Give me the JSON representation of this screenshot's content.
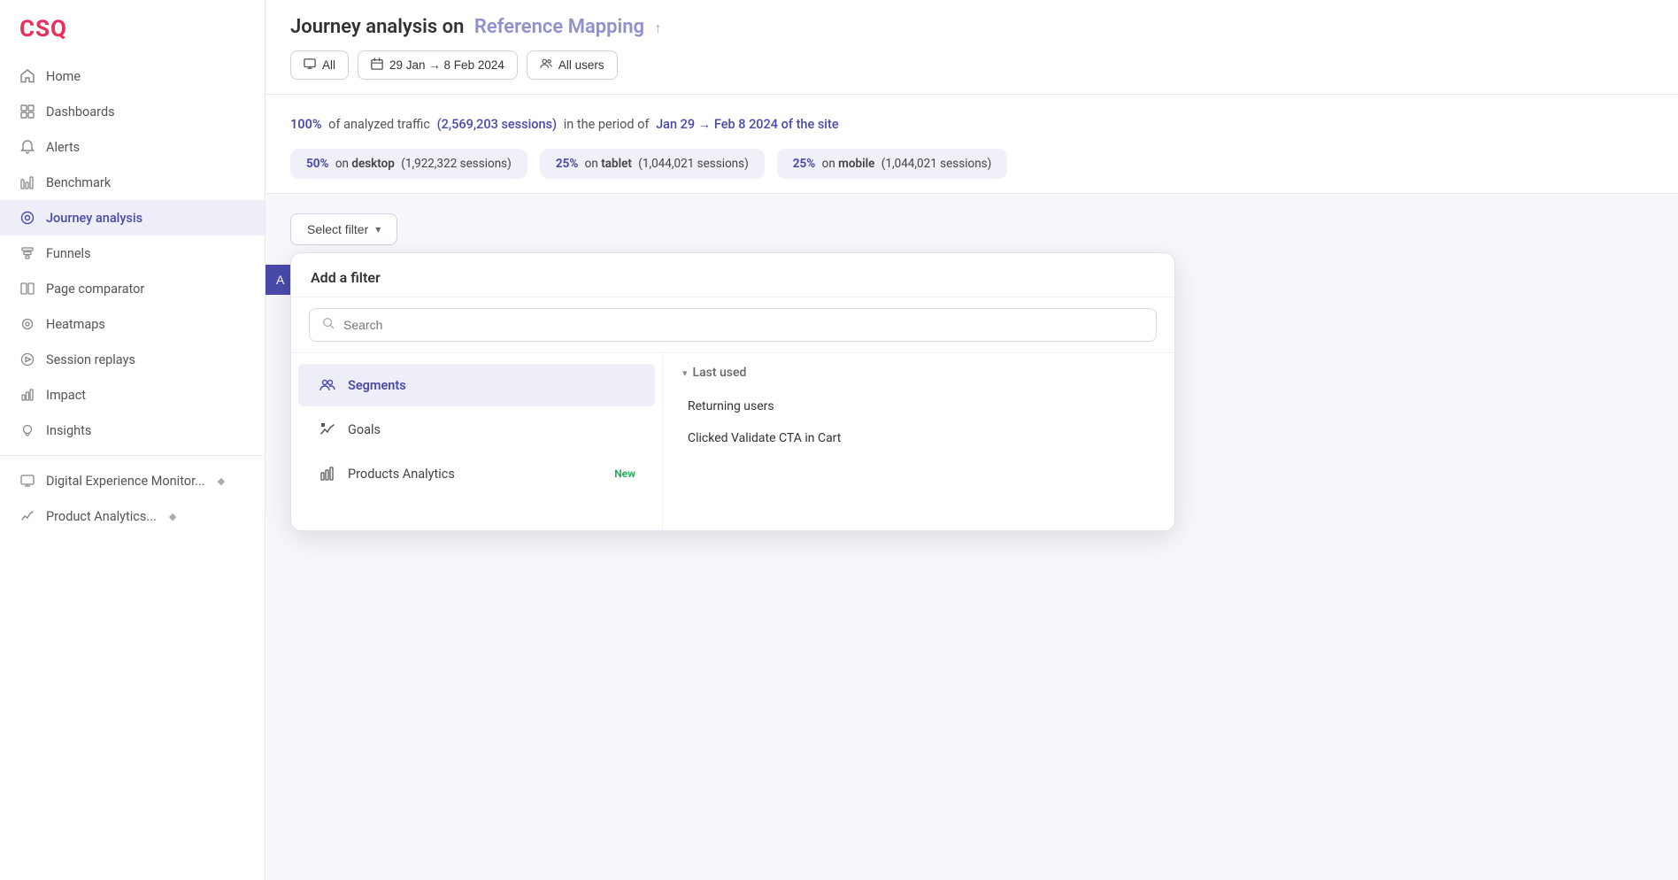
{
  "brand": {
    "logo": "CSQ",
    "logo_color": "#e8305a"
  },
  "sidebar": {
    "items": [
      {
        "id": "home",
        "label": "Home",
        "icon": "home"
      },
      {
        "id": "dashboards",
        "label": "Dashboards",
        "icon": "dashboards"
      },
      {
        "id": "alerts",
        "label": "Alerts",
        "icon": "alerts"
      },
      {
        "id": "benchmark",
        "label": "Benchmark",
        "icon": "benchmark"
      },
      {
        "id": "journey-analysis",
        "label": "Journey analysis",
        "icon": "journey",
        "active": true
      },
      {
        "id": "funnels",
        "label": "Funnels",
        "icon": "funnels"
      },
      {
        "id": "page-comparator",
        "label": "Page comparator",
        "icon": "page-comparator"
      },
      {
        "id": "heatmaps",
        "label": "Heatmaps",
        "icon": "heatmaps"
      },
      {
        "id": "session-replays",
        "label": "Session replays",
        "icon": "session-replays"
      },
      {
        "id": "impact",
        "label": "Impact",
        "icon": "impact"
      },
      {
        "id": "insights",
        "label": "Insights",
        "icon": "insights"
      }
    ],
    "bottom_items": [
      {
        "id": "digital-experience",
        "label": "Digital Experience Monitor...",
        "badge": "◆"
      },
      {
        "id": "product-analytics",
        "label": "Product Analytics...",
        "badge": "◆"
      }
    ]
  },
  "header": {
    "title_prefix": "Journey analysis on",
    "title_highlight": "Reference Mapping",
    "title_arrow": "↑"
  },
  "filter_bar": {
    "all_btn": "All",
    "date_btn": "29 Jan → 8 Feb 2024",
    "users_btn": "All users"
  },
  "stats": {
    "traffic_pct": "100%",
    "traffic_text": "of analyzed traffic",
    "sessions_count": "(2,569,203 sessions)",
    "period_text": "in the period of",
    "date_range": "Jan 29 → Feb 8 2024 of the site",
    "devices": [
      {
        "pct": "50%",
        "label": "desktop",
        "sessions": "(1,922,322 sessions)"
      },
      {
        "pct": "25%",
        "label": "tablet",
        "sessions": "(1,044,021 sessions)"
      },
      {
        "pct": "25%",
        "label": "mobile",
        "sessions": "(1,044,021 sessions)"
      }
    ]
  },
  "filter_section": {
    "select_filter_label": "Select filter",
    "dropdown": {
      "title": "Add a filter",
      "search_placeholder": "Search",
      "categories": [
        {
          "id": "segments",
          "label": "Segments",
          "icon": "segments",
          "active": true
        },
        {
          "id": "goals",
          "label": "Goals",
          "icon": "goals"
        },
        {
          "id": "products-analytics",
          "label": "Products Analytics",
          "icon": "products",
          "badge": "New"
        }
      ],
      "right_section": {
        "header": "Last used",
        "options": [
          "Returning users",
          "Clicked Validate CTA in Cart"
        ]
      }
    }
  },
  "action_button": "A"
}
